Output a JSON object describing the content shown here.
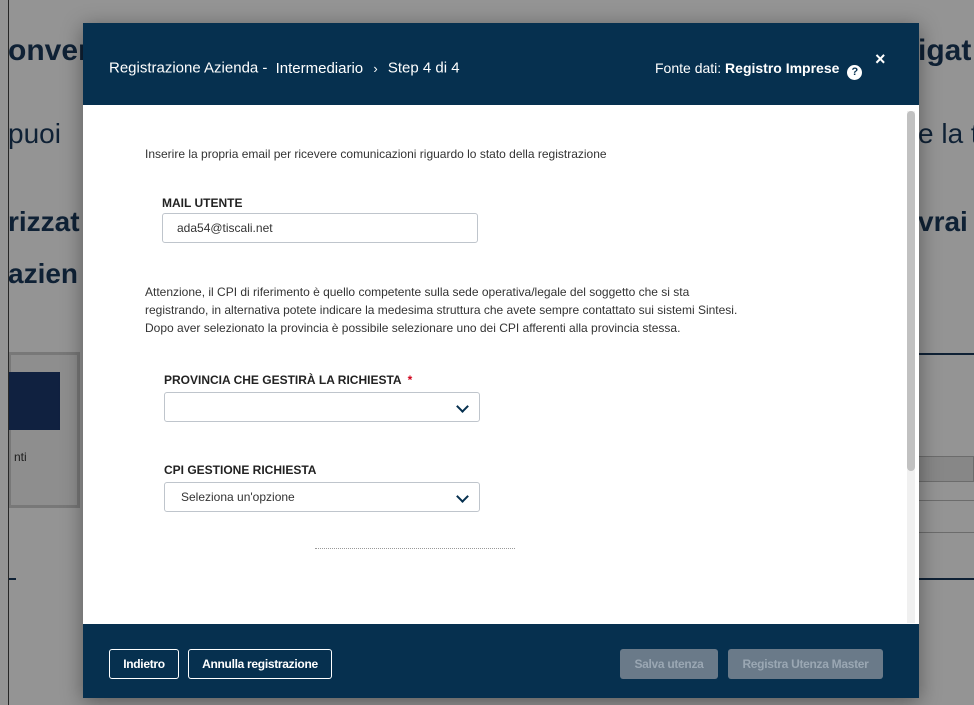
{
  "background": {
    "left_lines": [
      "onven",
      "puoi",
      "rizzat",
      "azien"
    ],
    "right_lines": [
      "igat",
      "e la t",
      "vrai"
    ],
    "small_text": "nti"
  },
  "modal": {
    "header": {
      "title_part1": "Registrazione Azienda -",
      "title_part2": "Intermediario",
      "separator": "›",
      "step": "Step 4 di 4",
      "source_label": "Fonte dati:",
      "source_value": "Registro Imprese",
      "help_icon": "?",
      "close_icon": "×"
    },
    "body": {
      "intro": "Inserire la propria email per ricevere comunicazioni riguardo lo stato della registrazione",
      "mail_label": "MAIL UTENTE",
      "mail_value": "ada54@tiscali.net",
      "notice_lines": [
        "Attenzione, il CPI di riferimento è quello competente sulla sede operativa/legale del soggetto che si sta",
        "registrando, in alternativa potete indicare la medesima struttura che avete sempre contattato sui sistemi Sintesi.",
        "Dopo aver selezionato la provincia è possibile selezionare uno dei CPI afferenti alla provincia stessa."
      ],
      "provincia_label": "PROVINCIA CHE GESTIRÀ LA RICHIESTA",
      "required_mark": "*",
      "provincia_value": "",
      "cpi_label": "CPI GESTIONE RICHIESTA",
      "cpi_value": "Seleziona un'opzione"
    },
    "footer": {
      "back": "Indietro",
      "cancel": "Annulla registrazione",
      "save": "Salva utenza",
      "register_master": "Registra Utenza Master"
    }
  },
  "colors": {
    "header_bg": "#06304f",
    "required": "#d0021b",
    "disabled_btn": "#6a7a89"
  }
}
